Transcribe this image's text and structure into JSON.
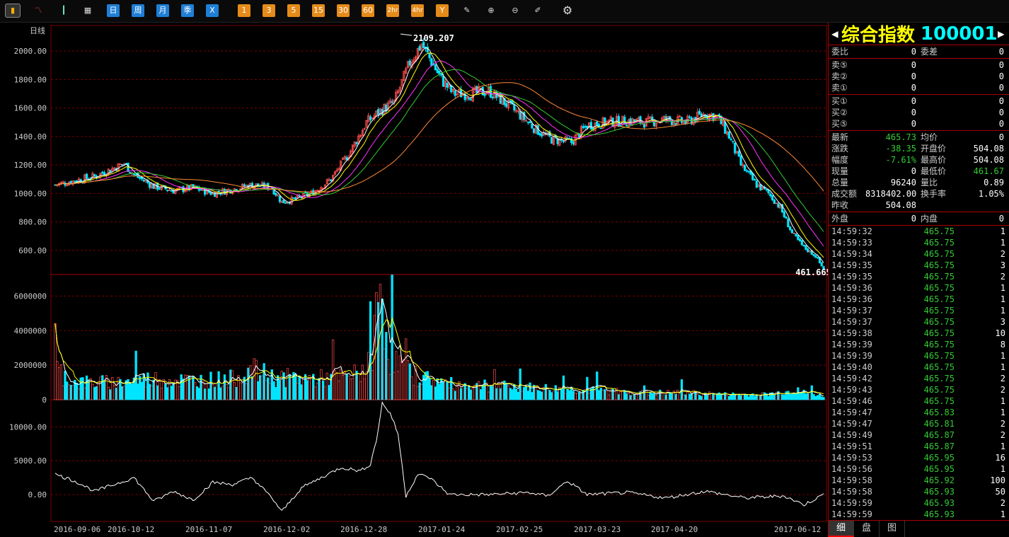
{
  "toolbar": {
    "left_icons": [
      "bar-chart-icon",
      "line-chart-icon",
      "candlestick-icon",
      "calendar-icon"
    ],
    "period_blue": [
      "日",
      "周",
      "月",
      "季",
      "X"
    ],
    "period_orange": [
      "1",
      "3",
      "5",
      "15",
      "30",
      "60",
      "2hr",
      "4hr",
      "Y"
    ],
    "tool_icons": [
      "edit-icon",
      "zoom-in-icon",
      "zoom-out-icon",
      "draw-icon"
    ],
    "settings_icon": "gear-icon"
  },
  "chart": {
    "period_label": "日线",
    "high_label": "2109.207",
    "low_label": "461.6652",
    "price_ticks": [
      "2000.00",
      "1800.00",
      "1600.00",
      "1400.00",
      "1200.00",
      "1000.00",
      "800.00",
      "600.00"
    ],
    "volume_ticks": [
      "6000000",
      "4000000",
      "2000000",
      "0"
    ],
    "indicator_ticks": [
      "10000.00",
      "5000.00",
      "0.00"
    ],
    "date_labels": [
      "2016-09-06",
      "2016-10-12",
      "2016-11-07",
      "2016-12-02",
      "2016-12-28",
      "2017-01-24",
      "2017-02-25",
      "2017-03-23",
      "2017-04-20",
      "2017-06-12"
    ],
    "colors": {
      "up": "#ff4d4d",
      "down": "#00e5ff",
      "ma5": "#ffffff",
      "ma10": "#ffff00",
      "ma20": "#ff33ff",
      "ma30": "#33cc33",
      "ma60": "#ff8833",
      "grid": "#7a0000"
    }
  },
  "chart_data": {
    "type": "candlestick",
    "price_ylim": [
      460,
      2110
    ],
    "volume_ylim": [
      0,
      7000000
    ],
    "indicator_ylim": [
      -2500,
      14000
    ],
    "close_path": [
      [
        0,
        1060
      ],
      [
        10,
        1090
      ],
      [
        20,
        1120
      ],
      [
        30,
        1180
      ],
      [
        35,
        1210
      ],
      [
        40,
        1130
      ],
      [
        50,
        1050
      ],
      [
        60,
        1020
      ],
      [
        70,
        1040
      ],
      [
        80,
        1000
      ],
      [
        90,
        1030
      ],
      [
        100,
        1060
      ],
      [
        110,
        1040
      ],
      [
        115,
        940
      ],
      [
        122,
        960
      ],
      [
        130,
        1000
      ],
      [
        140,
        1100
      ],
      [
        150,
        1300
      ],
      [
        158,
        1500
      ],
      [
        165,
        1580
      ],
      [
        172,
        1640
      ],
      [
        180,
        1920
      ],
      [
        186,
        2050
      ],
      [
        190,
        1950
      ],
      [
        196,
        1800
      ],
      [
        202,
        1700
      ],
      [
        212,
        1700
      ],
      [
        220,
        1720
      ],
      [
        228,
        1640
      ],
      [
        236,
        1550
      ],
      [
        244,
        1450
      ],
      [
        252,
        1380
      ],
      [
        262,
        1360
      ],
      [
        270,
        1480
      ],
      [
        280,
        1500
      ],
      [
        290,
        1510
      ],
      [
        300,
        1500
      ],
      [
        310,
        1520
      ],
      [
        320,
        1500
      ],
      [
        330,
        1560
      ],
      [
        336,
        1540
      ],
      [
        342,
        1400
      ],
      [
        348,
        1200
      ],
      [
        356,
        1060
      ],
      [
        362,
        1000
      ],
      [
        368,
        900
      ],
      [
        374,
        720
      ],
      [
        380,
        620
      ],
      [
        386,
        560
      ],
      [
        390,
        466
      ]
    ],
    "volume_path": [
      [
        0,
        1800000
      ],
      [
        10,
        1000000
      ],
      [
        30,
        1000000
      ],
      [
        50,
        1200000
      ],
      [
        70,
        1100000
      ],
      [
        90,
        1200000
      ],
      [
        100,
        1700000
      ],
      [
        110,
        1300000
      ],
      [
        130,
        1200000
      ],
      [
        150,
        1300000
      ],
      [
        160,
        2000000
      ],
      [
        165,
        6600000
      ],
      [
        170,
        2500000
      ],
      [
        180,
        1500000
      ],
      [
        200,
        900000
      ],
      [
        220,
        800000
      ],
      [
        240,
        700000
      ],
      [
        260,
        600000
      ],
      [
        280,
        500000
      ],
      [
        300,
        400000
      ],
      [
        320,
        400000
      ],
      [
        340,
        300000
      ],
      [
        360,
        300000
      ],
      [
        375,
        500000
      ],
      [
        390,
        200000
      ]
    ],
    "indicator_path": [
      [
        0,
        3000
      ],
      [
        10,
        2000
      ],
      [
        20,
        500
      ],
      [
        30,
        1500
      ],
      [
        40,
        2500
      ],
      [
        50,
        -1000
      ],
      [
        60,
        500
      ],
      [
        70,
        -800
      ],
      [
        80,
        1800
      ],
      [
        90,
        1500
      ],
      [
        100,
        2500
      ],
      [
        110,
        -500
      ],
      [
        115,
        -2500
      ],
      [
        125,
        1000
      ],
      [
        135,
        2500
      ],
      [
        145,
        4000
      ],
      [
        155,
        3500
      ],
      [
        160,
        4500
      ],
      [
        163,
        8000
      ],
      [
        166,
        13500
      ],
      [
        170,
        12000
      ],
      [
        174,
        9000
      ],
      [
        178,
        -200
      ],
      [
        184,
        3000
      ],
      [
        190,
        2500
      ],
      [
        200,
        0
      ],
      [
        220,
        0
      ],
      [
        240,
        300
      ],
      [
        250,
        -200
      ],
      [
        260,
        2000
      ],
      [
        270,
        0
      ],
      [
        290,
        300
      ],
      [
        310,
        -500
      ],
      [
        330,
        500
      ],
      [
        350,
        -500
      ],
      [
        370,
        -200
      ],
      [
        380,
        -1500
      ],
      [
        390,
        0
      ]
    ]
  },
  "panel": {
    "title_name": "综合指数",
    "title_code": "100001",
    "rows_top": [
      {
        "l1": "委比",
        "v1": "0",
        "l2": "委差",
        "v2": "0"
      }
    ],
    "sell": [
      {
        "l1": "卖⑤",
        "v1": "0",
        "v2": "0"
      },
      {
        "l1": "卖②",
        "v1": "0",
        "v2": "0"
      },
      {
        "l1": "卖①",
        "v1": "0",
        "v2": "0"
      }
    ],
    "buy": [
      {
        "l1": "买①",
        "v1": "0",
        "v2": "0"
      },
      {
        "l1": "买②",
        "v1": "0",
        "v2": "0"
      },
      {
        "l1": "买⑤",
        "v1": "0",
        "v2": "0"
      }
    ],
    "stats": [
      {
        "l1": "最新",
        "v1": "465.73",
        "c1": "green",
        "l2": "均价",
        "v2": "0",
        "c2": "white"
      },
      {
        "l1": "涨跌",
        "v1": "-38.35",
        "c1": "green",
        "l2": "开盘价",
        "v2": "504.08",
        "c2": "white"
      },
      {
        "l1": "幅度",
        "v1": "-7.61%",
        "c1": "green",
        "l2": "最高价",
        "v2": "504.08",
        "c2": "white"
      },
      {
        "l1": "现量",
        "v1": "0",
        "c1": "white",
        "l2": "最低价",
        "v2": "461.67",
        "c2": "green"
      },
      {
        "l1": "总量",
        "v1": "96240",
        "c1": "white",
        "l2": "量比",
        "v2": "0.89",
        "c2": "white"
      },
      {
        "l1": "成交额",
        "v1": "8318402.00",
        "c1": "white",
        "l2": "换手率",
        "v2": "1.05%",
        "c2": "white"
      },
      {
        "l1": "昨收",
        "v1": "504.08",
        "c1": "white",
        "l2": "",
        "v2": "",
        "c2": "white"
      }
    ],
    "outer_inner": {
      "l1": "外盘",
      "v1": "0",
      "l2": "内盘",
      "v2": "0"
    },
    "ticks": [
      [
        "14:59:32",
        "465.75",
        "1"
      ],
      [
        "14:59:33",
        "465.75",
        "1"
      ],
      [
        "14:59:34",
        "465.75",
        "2"
      ],
      [
        "14:59:35",
        "465.75",
        "3"
      ],
      [
        "14:59:35",
        "465.75",
        "2"
      ],
      [
        "14:59:36",
        "465.75",
        "1"
      ],
      [
        "14:59:36",
        "465.75",
        "1"
      ],
      [
        "14:59:37",
        "465.75",
        "1"
      ],
      [
        "14:59:37",
        "465.75",
        "3"
      ],
      [
        "14:59:38",
        "465.75",
        "10"
      ],
      [
        "14:59:39",
        "465.75",
        "8"
      ],
      [
        "14:59:39",
        "465.75",
        "1"
      ],
      [
        "14:59:40",
        "465.75",
        "1"
      ],
      [
        "14:59:42",
        "465.75",
        "2"
      ],
      [
        "14:59:43",
        "465.75",
        "2"
      ],
      [
        "14:59:46",
        "465.75",
        "1"
      ],
      [
        "14:59:47",
        "465.83",
        "1"
      ],
      [
        "14:59:47",
        "465.81",
        "2"
      ],
      [
        "14:59:49",
        "465.87",
        "2"
      ],
      [
        "14:59:51",
        "465.87",
        "1"
      ],
      [
        "14:59:53",
        "465.95",
        "16"
      ],
      [
        "14:59:56",
        "465.95",
        "1"
      ],
      [
        "14:59:58",
        "465.92",
        "100"
      ],
      [
        "14:59:58",
        "465.93",
        "50"
      ],
      [
        "14:59:59",
        "465.93",
        "2"
      ],
      [
        "14:59:59",
        "465.93",
        "1"
      ]
    ],
    "tabs": [
      "细",
      "盘",
      "图"
    ]
  }
}
